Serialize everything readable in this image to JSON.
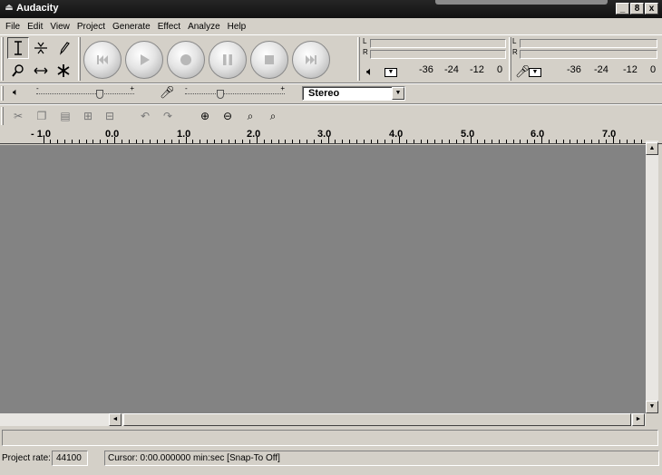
{
  "window": {
    "title": "Audacity",
    "controls": [
      "_",
      "8",
      "x"
    ]
  },
  "menu": [
    "File",
    "Edit",
    "View",
    "Project",
    "Generate",
    "Effect",
    "Analyze",
    "Help"
  ],
  "tools": [
    {
      "name": "selection-tool",
      "glyph": "I"
    },
    {
      "name": "envelope-tool",
      "glyph": "⇆"
    },
    {
      "name": "draw-tool",
      "glyph": "✎"
    },
    {
      "name": "zoom-tool",
      "glyph": "⌕"
    },
    {
      "name": "time-shift-tool",
      "glyph": "↔"
    },
    {
      "name": "multi-tool",
      "glyph": "✱"
    }
  ],
  "meters": {
    "playback": {
      "channels": [
        "L",
        "R"
      ],
      "scale": [
        "-36",
        "-24",
        "-12",
        "0"
      ]
    },
    "record": {
      "channels": [
        "L",
        "R"
      ],
      "scale": [
        "-36",
        "-24",
        "-12",
        "0"
      ]
    }
  },
  "mixer": {
    "output_min": "-",
    "output_max": "+",
    "input_min": "-",
    "input_max": "+",
    "output_level": 0.67,
    "input_level": 0.35,
    "input_source": "Stereo"
  },
  "ruler": {
    "labels": [
      "- 1.0",
      "0.0",
      "1.0",
      "2.0",
      "3.0",
      "4.0",
      "5.0",
      "6.0",
      "7.0"
    ]
  },
  "status": {
    "project_rate_label": "Project rate:",
    "project_rate": "44100",
    "cursor": "Cursor: 0:00.000000 min:sec  [Snap-To Off]"
  },
  "colors": {
    "chrome": "#d4d0c8",
    "track_bg": "#838383",
    "titlebar": "#1a1a1a"
  }
}
